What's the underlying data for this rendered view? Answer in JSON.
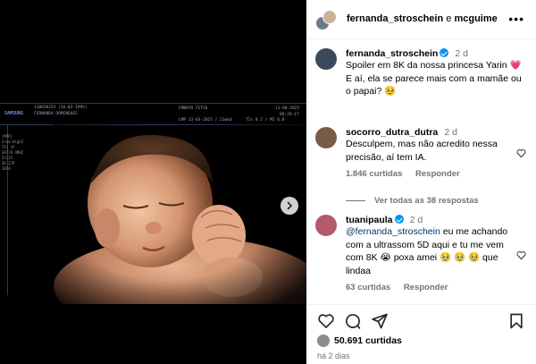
{
  "media": {
    "ultrasound_overlay": {
      "brand": "SAMSUNG",
      "patient_id": "110620253 (16-03-1995)",
      "patient_name": "FERNANDA DOMINGUES",
      "probe": "EMBRYO FETUS",
      "date": "11-08-2025",
      "time": "09:29:17",
      "lmp": "LMP 13-03-2025 / 21wkd",
      "tis": "TIs 0.2 / MI 0.8",
      "side_panel": "[MPR]\nGrad HighZ\nTIs 4f\nSAT/H 4MHZ\n55/35\n2D 27P\n3DFA"
    },
    "next_icon": "chevron-right-icon"
  },
  "header": {
    "user1": "fernanda_stroschein",
    "separator": "e",
    "user2": "mcguime",
    "more_icon": "more-horizontal-icon"
  },
  "caption": {
    "username": "fernanda_stroschein",
    "ago": "2 d",
    "line1": "Spoiler em 8K da nossa princesa Yarin 💗",
    "line2": "E aí, ela se parece mais com a mamãe ou o papai? 🥹"
  },
  "comments": [
    {
      "username": "socorro_dutra_dutra",
      "ago": "2 d",
      "text": "Desculpem, mas não acredito nessa precisão, aí tem IA.",
      "likes": "1.846 curtidas",
      "reply": "Responder"
    },
    {
      "username": "tuanipaula",
      "ago": "2 d",
      "mention": "@fernanda_stroschein",
      "text": " eu me achando com a ultrassom 5D aqui e tu me vem com 8K 😭 poxa amei 🥹 🥹 🥹 que lindaa",
      "likes": "63 curtidas",
      "reply": "Responder"
    }
  ],
  "view_replies": "Ver todas as 38 respostas",
  "actions": {
    "like_icon": "heart-icon",
    "comment_icon": "comment-icon",
    "share_icon": "share-icon",
    "save_icon": "bookmark-icon"
  },
  "likes_count": "50.691 curtidas",
  "posted_ago": "há 2 dias"
}
